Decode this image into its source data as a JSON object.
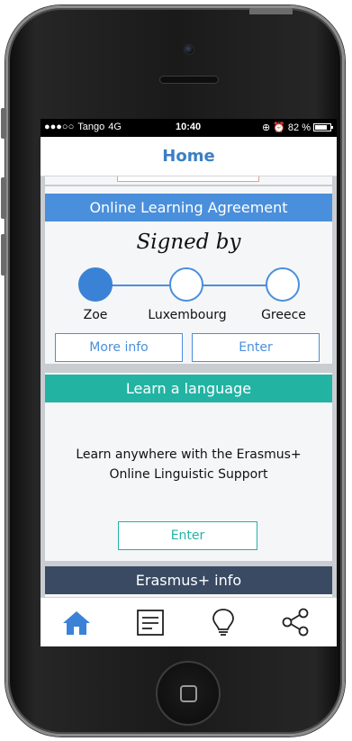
{
  "status_bar": {
    "carrier_dots": "●●●○○",
    "carrier": "Tango",
    "network": "4G",
    "time": "10:40",
    "icons": "⊕ ⏰",
    "battery": "82 %"
  },
  "nav": {
    "title": "Home"
  },
  "learning_agreement": {
    "header": "Online Learning Agreement",
    "signed_by": "Signed by",
    "steps": [
      {
        "label": "Zoe",
        "signed": true
      },
      {
        "label": "Luxembourg",
        "signed": false
      },
      {
        "label": "Greece",
        "signed": false
      }
    ],
    "more_info_label": "More info",
    "enter_label": "Enter"
  },
  "language": {
    "header": "Learn a language",
    "text_line1": "Learn anywhere with the Erasmus+",
    "text_line2": "Online Linguistic Support",
    "enter_label": "Enter"
  },
  "info": {
    "header": "Erasmus+ info"
  },
  "tabbar": {
    "items": [
      {
        "icon": "home-icon",
        "active": true
      },
      {
        "icon": "document-icon",
        "active": false
      },
      {
        "icon": "lightbulb-icon",
        "active": false
      },
      {
        "icon": "share-icon",
        "active": false
      }
    ]
  },
  "colors": {
    "accent_blue": "#4a8fdc",
    "teal": "#22b3a3",
    "navy": "#3a4a63",
    "title_blue": "#3a7fc4"
  }
}
